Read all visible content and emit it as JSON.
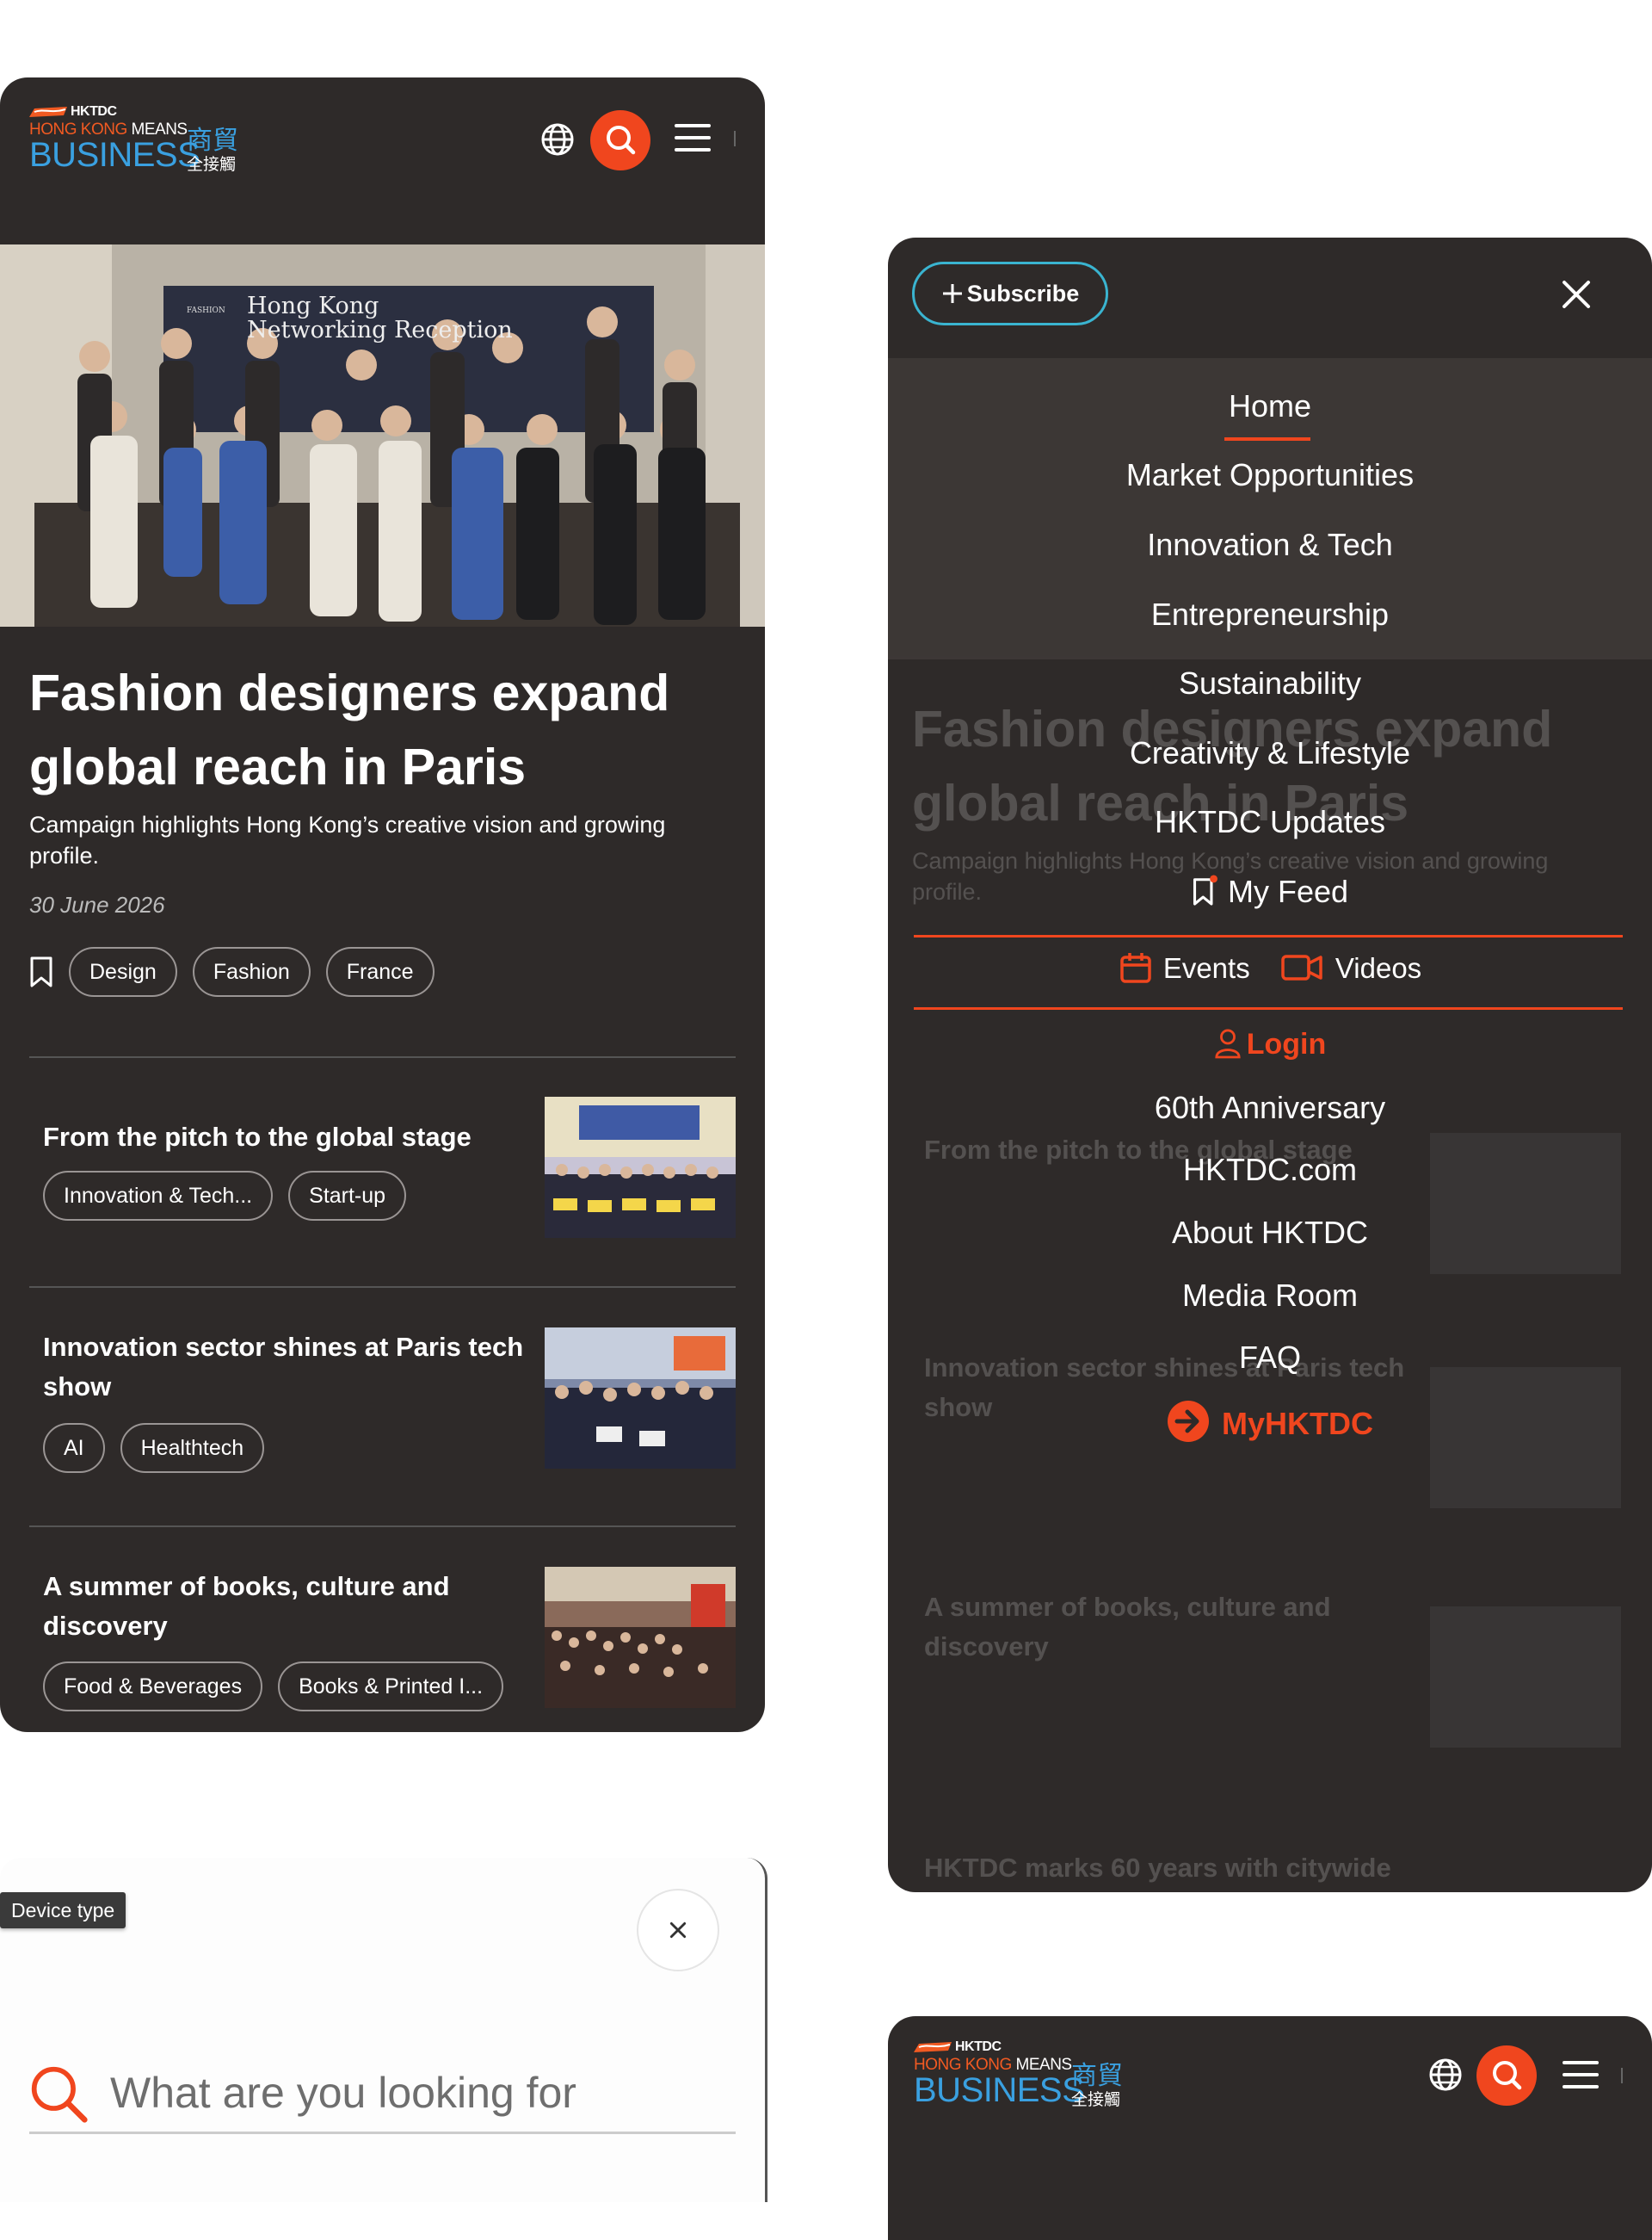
{
  "header": {
    "logo_small": "HKTDC",
    "logo_line1": "HONG KONG",
    "logo_line1b": "MEANS",
    "logo_big": "BUSINESS",
    "logo_cn_top": "商貿",
    "logo_cn_bottom": "全接觸"
  },
  "article": {
    "headline": "Fashion designers expand global reach in Paris",
    "standfirst": "Campaign highlights Hong Kong’s creative vision and growing profile.",
    "date": "30 June 2026",
    "tags": [
      "Design",
      "Fashion",
      "France"
    ],
    "hero_banner_line1": "Hong Kong",
    "hero_banner_line2": "Networking Reception",
    "hero_banner_small": "FASHION"
  },
  "stories": [
    {
      "title": "From the pitch to the global stage",
      "tags": [
        "Innovation & Tech...",
        "Start-up"
      ]
    },
    {
      "title": "Innovation sector shines at Paris tech show",
      "tags": [
        "AI",
        "Healthtech"
      ]
    },
    {
      "title": "A summer of books, culture and discovery",
      "tags": [
        "Food & Beverages",
        "Books & Printed I..."
      ]
    }
  ],
  "ghost_story_4": "HKTDC marks 60 years with citywide",
  "menu": {
    "subscribe_label": "Subscribe",
    "items": [
      "Home",
      "Market Opportunities",
      "Innovation & Tech",
      "Entrepreneurship",
      "Sustainability",
      "Creativity & Lifestyle",
      "HKTDC Updates"
    ],
    "my_feed": "My Feed",
    "events": "Events",
    "videos": "Videos",
    "login": "Login",
    "secondary": [
      "60th Anniversary",
      "HKTDC.com",
      "About HKTDC",
      "Media Room",
      "FAQ"
    ],
    "myhktdc": "MyHKTDC"
  },
  "search": {
    "device_type_label": "Device type",
    "placeholder": "What are you looking for"
  },
  "colors": {
    "dark_bg": "#2e2a29",
    "accent_orange": "#f0461e",
    "logo_blue": "#3aa0e0",
    "subscribe_border": "#3ab4d0"
  }
}
